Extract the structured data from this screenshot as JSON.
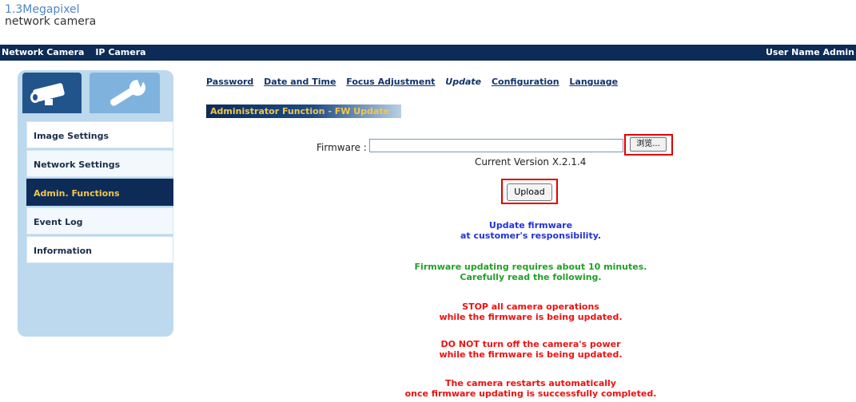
{
  "brand": {
    "line1": "1.3Megapixel",
    "line2": "network camera"
  },
  "topbar": {
    "item1": "Network Camera",
    "item2": "IP Camera",
    "user": "User Name Admin"
  },
  "sidebar": {
    "items": [
      {
        "label": "Image Settings"
      },
      {
        "label": "Network Settings"
      },
      {
        "label": "Admin. Functions"
      },
      {
        "label": "Event Log"
      },
      {
        "label": "Information"
      }
    ]
  },
  "subnav": {
    "items": [
      {
        "label": "Password"
      },
      {
        "label": "Date and Time"
      },
      {
        "label": "Focus Adjustment"
      },
      {
        "label": "Update"
      },
      {
        "label": "Configuration"
      },
      {
        "label": "Language"
      }
    ]
  },
  "section": {
    "title": "Administrator Function - FW Update"
  },
  "firmware": {
    "label": "Firmware :",
    "value": "",
    "browse": "浏览...",
    "current_version": "Current Version X.2.1.4"
  },
  "upload": {
    "label": "Upload"
  },
  "messages": {
    "blue1": "Update firmware",
    "blue2": "at customer's responsibility.",
    "green1": "Firmware updating requires about 10 minutes.",
    "green2": "Carefully read the following.",
    "red1a": "STOP all camera operations",
    "red1b": "while the firmware is being updated.",
    "red2a": "DO NOT turn off the camera's power",
    "red2b": "while the firmware is being updated.",
    "red3a": "The camera restarts automatically",
    "red3b": "once firmware updating is successfully completed."
  },
  "colors": {
    "nav": "#0d2b57",
    "accent_yellow": "#f2c74a",
    "sidebar_bg": "#bcd9ee",
    "highlight_red": "#e00000",
    "msg_blue": "#2233dd",
    "msg_green": "#22a028",
    "msg_red": "#ee1111"
  },
  "icons": {
    "camera_tab": "camera-icon",
    "tools_tab": "wrench-icon"
  }
}
